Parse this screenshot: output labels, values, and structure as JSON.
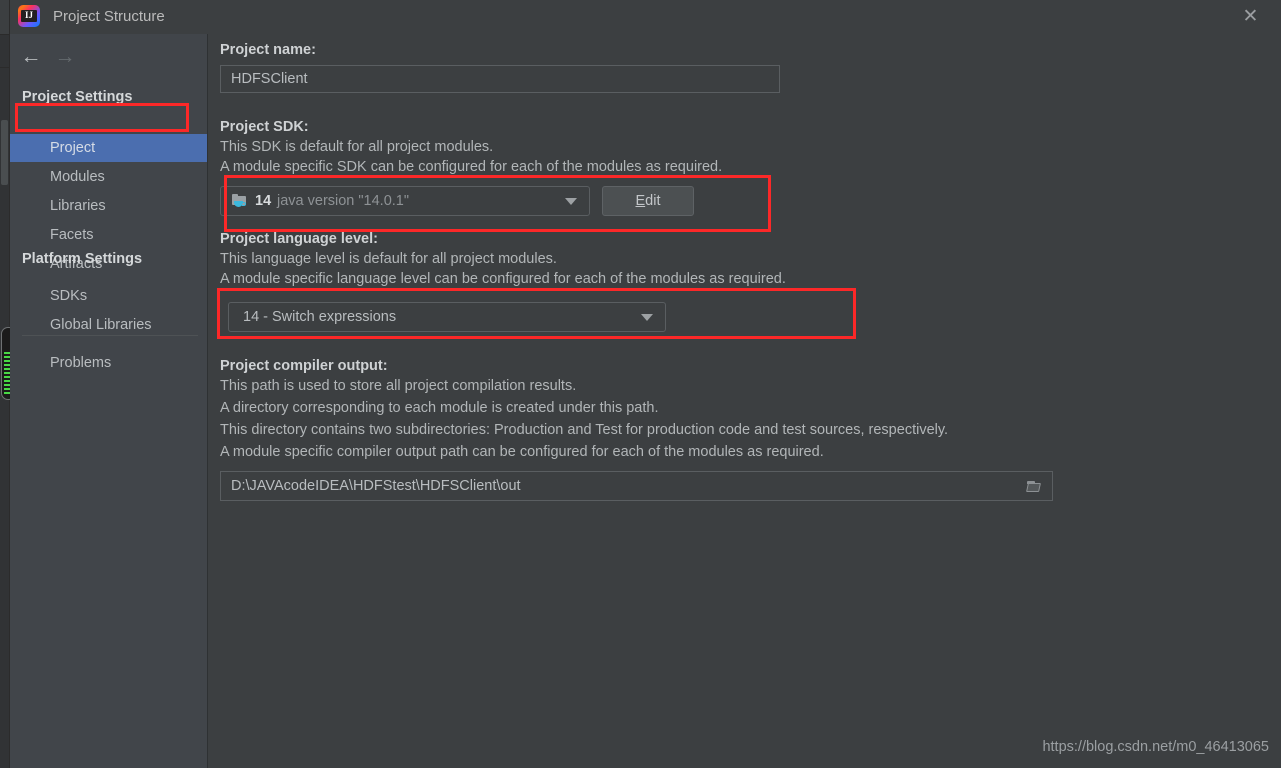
{
  "window": {
    "title": "Project Structure",
    "app_icon": "intellij-idea-icon",
    "icon_letters": "IJ",
    "close_label": "✕"
  },
  "sidebar": {
    "nav": {
      "back": "←",
      "forward": "→"
    },
    "sections": [
      {
        "label": "Project Settings"
      },
      {
        "label": "Platform Settings"
      }
    ],
    "items": [
      {
        "label": "Project",
        "selected": true
      },
      {
        "label": "Modules",
        "selected": false
      },
      {
        "label": "Libraries",
        "selected": false
      },
      {
        "label": "Facets",
        "selected": false
      },
      {
        "label": "Artifacts",
        "selected": false
      },
      {
        "label": "SDKs",
        "selected": false
      },
      {
        "label": "Global Libraries",
        "selected": false
      },
      {
        "label": "Problems",
        "selected": false
      }
    ]
  },
  "main": {
    "project_name": {
      "label": "Project name:",
      "value": "HDFSClient"
    },
    "project_sdk": {
      "label": "Project SDK:",
      "desc1": "This SDK is default for all project modules.",
      "desc2": "A module specific SDK can be configured for each of the modules as required.",
      "sdk_number": "14",
      "sdk_version": "java version \"14.0.1\"",
      "sdk_icon": "java-sdk-folder-icon",
      "edit_button_mnemonic": "E",
      "edit_button_rest": "dit"
    },
    "language_level": {
      "label": "Project language level:",
      "desc1": "This language level is default for all project modules.",
      "desc2": "A module specific language level can be configured for each of the modules as required.",
      "value": "14 - Switch expressions"
    },
    "compiler_output": {
      "label": "Project compiler output:",
      "desc1": "This path is used to store all project compilation results.",
      "desc2": "A directory corresponding to each module is created under this path.",
      "desc3": "This directory contains two subdirectories: Production and Test for production code and test sources, respectively.",
      "desc4": "A module specific compiler output path can be configured for each of the modules as required.",
      "value": "D:\\JAVAcodeIDEA\\HDFStest\\HDFSClient\\out",
      "browse_icon": "open-folder-icon"
    }
  },
  "watermark": "https://blog.csdn.net/m0_46413065",
  "colors": {
    "panel_bg": "#3c3f41",
    "sidebar_bg": "#41454a",
    "selection_blue": "#4b6eaf",
    "annotation_red": "#fc2828",
    "memory_green": "#49d845",
    "java_cup_blue": "#3bb8dd"
  }
}
